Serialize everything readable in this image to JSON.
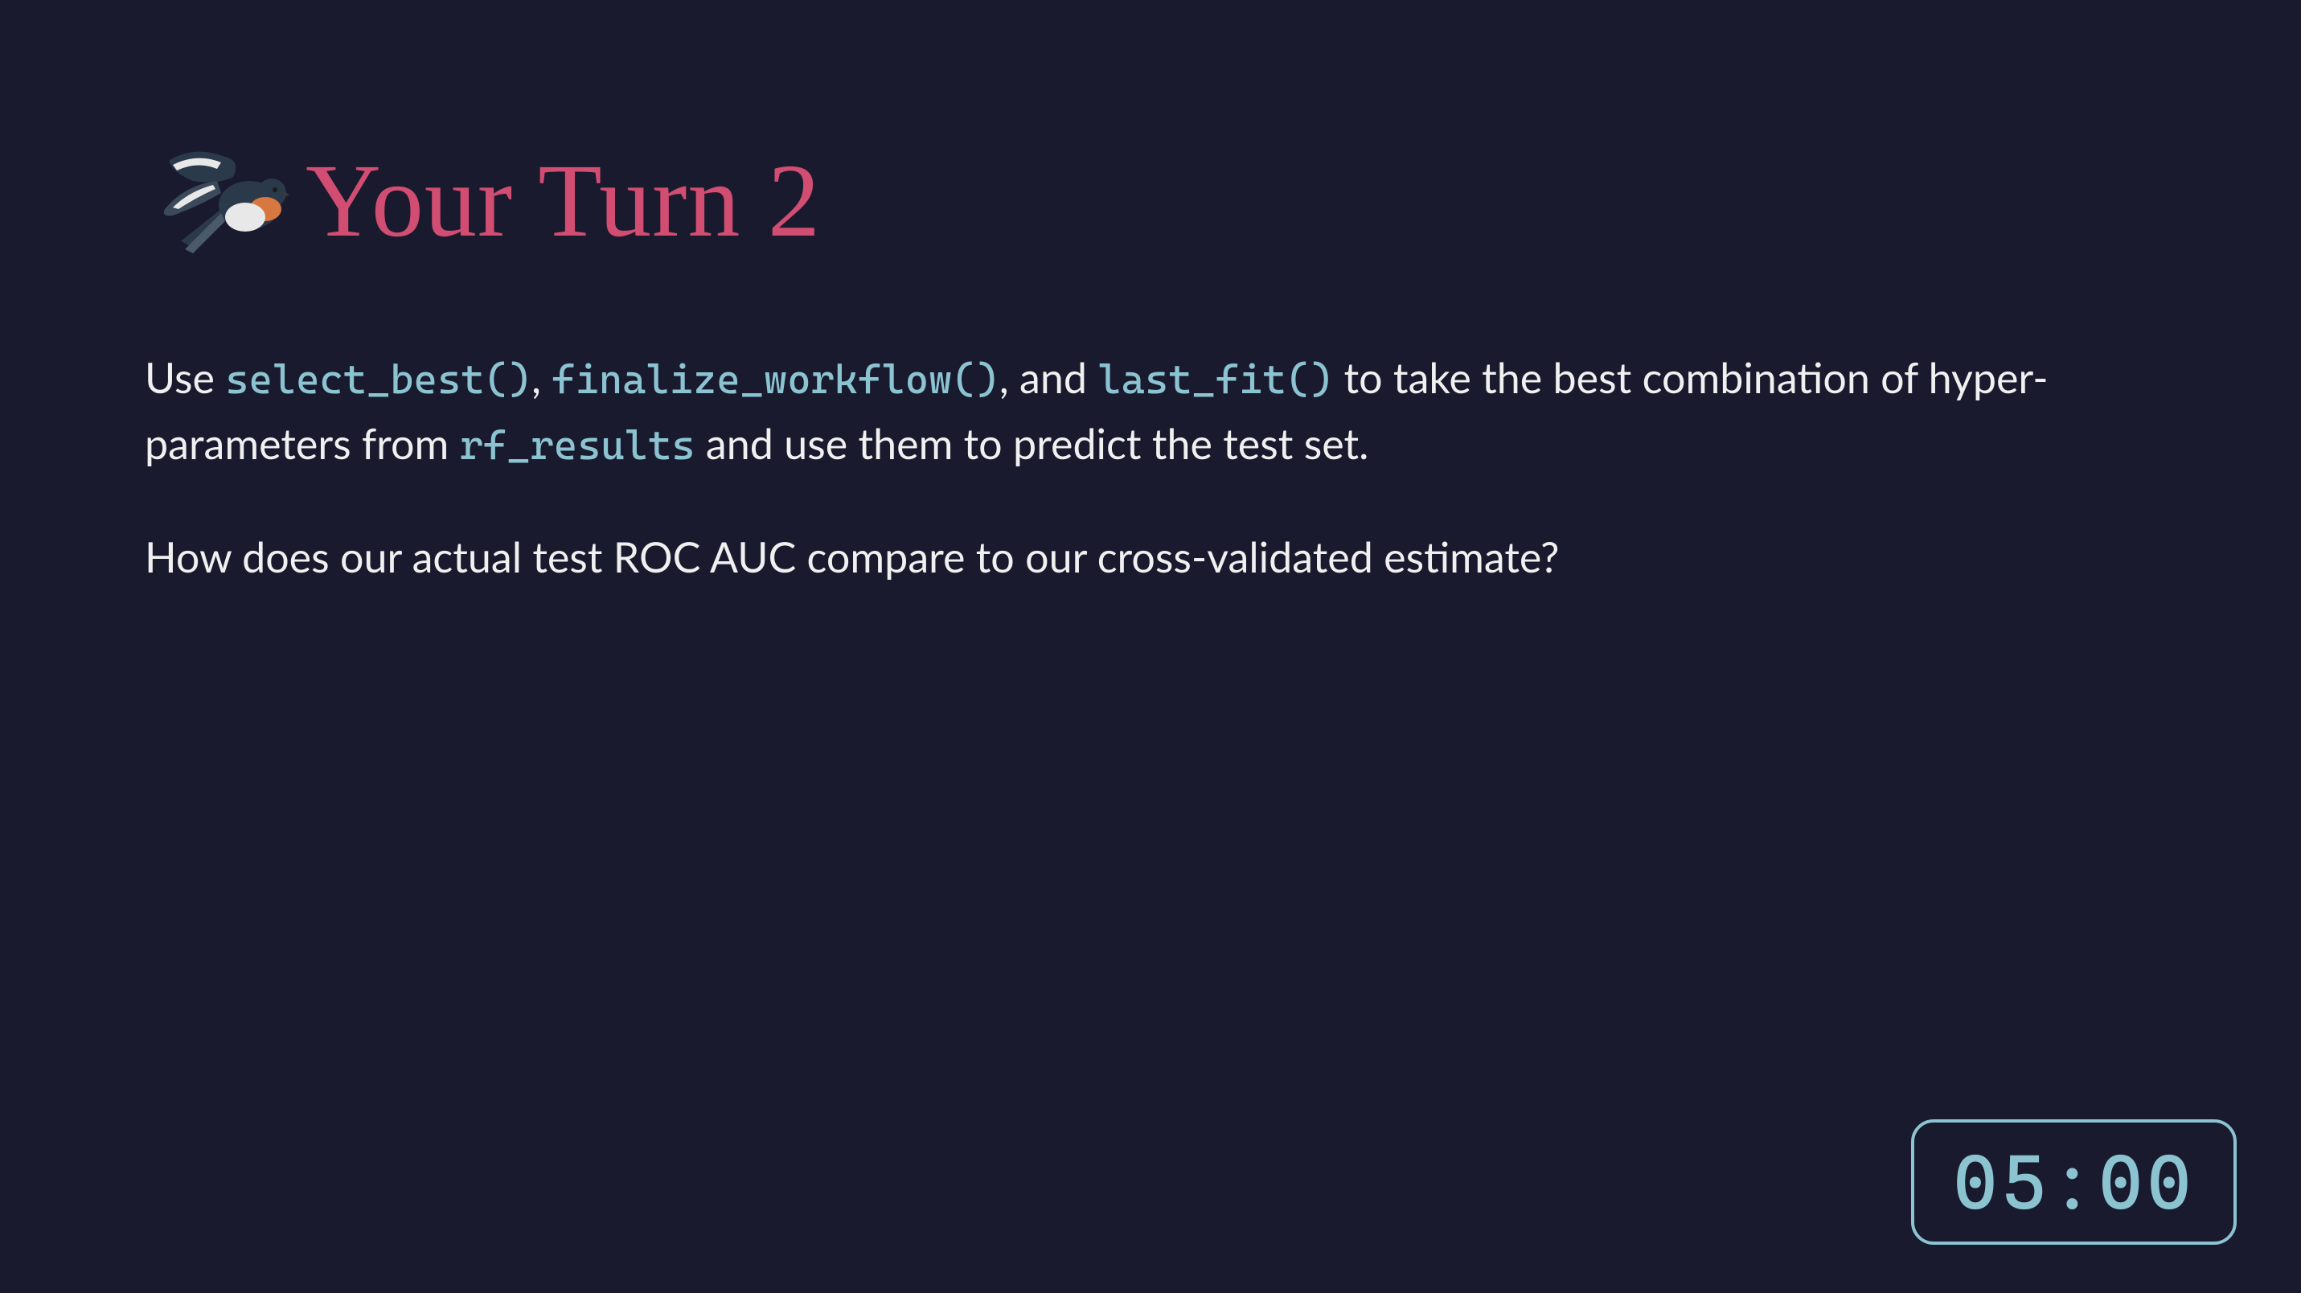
{
  "title": "Your Turn 2",
  "body": {
    "p1_part1": "Use ",
    "code1": "select_best()",
    "p1_part2": ", ",
    "code2": "finalize_workflow()",
    "p1_part3": ", and ",
    "code3": "last_fit()",
    "p1_part4": " to take the best combination of hyper-parameters from ",
    "code4": "rf_results",
    "p1_part5": " and use them to predict the test set.",
    "p2": "How does our actual test ROC AUC compare to our cross-validated estimate?"
  },
  "timer": "05:00"
}
